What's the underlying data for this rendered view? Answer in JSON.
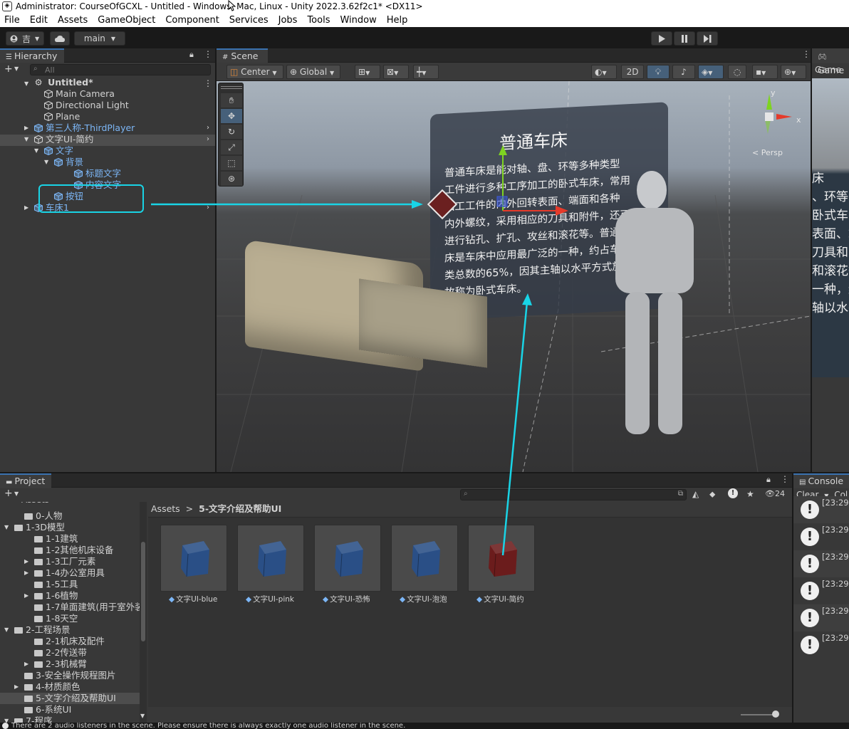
{
  "window": {
    "title": "Administrator: CourseOfGCXL - Untitled - Windows, Mac, Linux - Unity 2022.3.62f2c1* <DX11>"
  },
  "menu": [
    "File",
    "Edit",
    "Assets",
    "GameObject",
    "Component",
    "Services",
    "Jobs",
    "Tools",
    "Window",
    "Help"
  ],
  "toolbar": {
    "account_label": "吉",
    "branch_label": "main"
  },
  "hierarchy": {
    "tab": "Hierarchy",
    "search_placeholder": "All",
    "scene_name": "Untitled*",
    "items": [
      {
        "label": "Main Camera",
        "color": "#d2d2d2"
      },
      {
        "label": "Directional Light",
        "color": "#d2d2d2"
      },
      {
        "label": "Plane",
        "color": "#d2d2d2"
      },
      {
        "label": "第三人称-ThirdPlayer",
        "color": "#7cb6f6"
      },
      {
        "label": "文字UI-简约",
        "color": "#d2d2d2"
      },
      {
        "label": "文字",
        "color": "#7cb6f6"
      },
      {
        "label": "背景",
        "color": "#7cb6f6"
      },
      {
        "label": "标题文字",
        "color": "#7cb6f6"
      },
      {
        "label": "内容文字",
        "color": "#7cb6f6"
      },
      {
        "label": "按钮",
        "color": "#7cb6f6"
      },
      {
        "label": "车床1",
        "color": "#7cb6f6"
      }
    ]
  },
  "scene": {
    "tab": "Scene",
    "pivot_label": "Center",
    "space_label": "Global",
    "mode_2d": "2D",
    "persp_label": "< Persp",
    "billboard_title": "普通车床",
    "billboard_lines": [
      "普通车床是能对轴、盘、环等多种类型",
      "工件进行多种工序加工的卧式车床，常用",
      "加工工件的内外回转表面、端面和各种",
      "内外螺纹，采用相应的刀具和附件，还可",
      "进行钻孔、扩孔、攻丝和滚花等。普通车",
      "床是车床中应用最广泛的一种，约占车床",
      "类总数的65%，因其主轴以水平方式放置",
      "故称为卧式车床。"
    ],
    "gizmo_axes": {
      "y": "y",
      "x": "x"
    }
  },
  "game": {
    "tab": "Game",
    "label": "Game",
    "preview_lines": [
      "床",
      "、环等",
      "卧式车",
      "表面、端",
      "刀具和附",
      "和滚花等",
      "一种，约",
      "轴以水平"
    ]
  },
  "project": {
    "tab": "Project",
    "breadcrumb_root": "Assets",
    "breadcrumb_sep": ">",
    "breadcrumb_current": "5-文字介绍及帮助UI",
    "hidden_count": "24",
    "folders": [
      {
        "label": "0-人物",
        "indent": 1
      },
      {
        "label": "1-3D模型",
        "indent": 0
      },
      {
        "label": "1-1建筑",
        "indent": 2
      },
      {
        "label": "1-2其他机床设备",
        "indent": 2
      },
      {
        "label": "1-3工厂元素",
        "indent": 2
      },
      {
        "label": "1-4办公室用具",
        "indent": 2
      },
      {
        "label": "1-5工具",
        "indent": 2
      },
      {
        "label": "1-6植物",
        "indent": 2
      },
      {
        "label": "1-7单面建筑(用于室外装",
        "indent": 2
      },
      {
        "label": "1-8天空",
        "indent": 2
      },
      {
        "label": "2-工程场景",
        "indent": 0
      },
      {
        "label": "2-1机床及配件",
        "indent": 2
      },
      {
        "label": "2-2传送带",
        "indent": 2
      },
      {
        "label": "2-3机械臂",
        "indent": 2
      },
      {
        "label": "3-安全操作规程图片",
        "indent": 1
      },
      {
        "label": "4-材质颜色",
        "indent": 1
      },
      {
        "label": "5-文字介绍及帮助UI",
        "indent": 1
      },
      {
        "label": "6-系统UI",
        "indent": 1
      },
      {
        "label": "7-程序",
        "indent": 0
      }
    ],
    "assets": [
      {
        "label": "文字UI-blue",
        "color": "#2a4f86"
      },
      {
        "label": "文字UI-pink",
        "color": "#2a4f86"
      },
      {
        "label": "文字UI-恐怖",
        "color": "#2a4f86"
      },
      {
        "label": "文字UI-泡泡",
        "color": "#2a4f86"
      },
      {
        "label": "文字UI-简约",
        "color": "#6b1c1c"
      }
    ]
  },
  "console": {
    "tab": "Console",
    "clear_label": "Clear",
    "collapse_label": "Col",
    "entries": [
      "[23:29:",
      "[23:29:",
      "[23:29:",
      "[23:29:",
      "[23:29:",
      "[23:29:"
    ]
  },
  "status": {
    "message": "There are 2 audio listeners in the scene. Please ensure there is always exactly one audio listener in the scene."
  },
  "colors": {
    "accent_cyan": "#19d4e6",
    "selection_blue": "#2c5d87",
    "prefab_blue": "#7cb6f6"
  }
}
